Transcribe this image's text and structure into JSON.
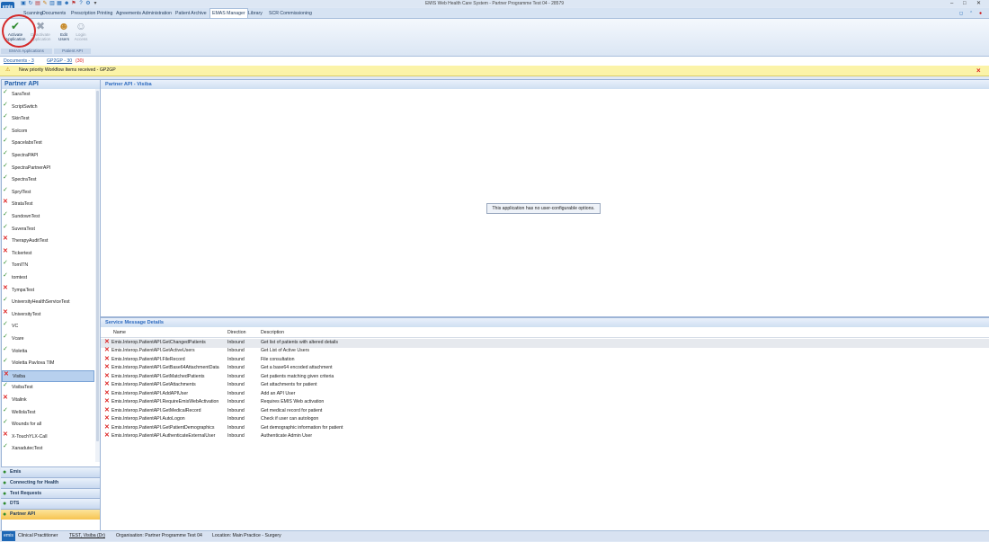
{
  "window": {
    "title": "EMIS Web Health Care System - Partner Programme Test 04 - 28579",
    "controls": [
      "–",
      "□",
      "✕"
    ]
  },
  "logo": "emis",
  "tabs": [
    "Scanning",
    "Documents",
    "Prescription Printing",
    "Agreements Administration",
    "Patient Archive",
    "EMAS Manager",
    "Library",
    "SCR Commissioning"
  ],
  "active_tab": "EMAS Manager",
  "ribbon": {
    "buttons": [
      {
        "label1": "Activate",
        "label2": "Application",
        "icon": "check-icon",
        "enabled": true
      },
      {
        "label1": "Deactivate",
        "label2": "Application",
        "icon": "cross-icon",
        "enabled": false
      },
      {
        "label1": "Edit",
        "label2": "Users",
        "icon": "users-icon",
        "enabled": true
      },
      {
        "label1": "Login",
        "label2": "Access",
        "icon": "login-icon",
        "enabled": false
      }
    ],
    "groups": [
      "EMAS Applications",
      "Patient API"
    ]
  },
  "breadcrumb": {
    "documents": "Documents - 3",
    "gp2gp": "GP2GP - 30",
    "gp2gp_count": "(30)"
  },
  "notification": {
    "text": "New priority Workflow Items received - GP2GP"
  },
  "left_panel": {
    "title": "Partner API",
    "items": [
      {
        "name": "SaraTest",
        "status": "check"
      },
      {
        "name": "ScriptSwitch",
        "status": "check"
      },
      {
        "name": "SkinTest",
        "status": "check"
      },
      {
        "name": "Solcom",
        "status": "check"
      },
      {
        "name": "SpacelabsTest",
        "status": "check"
      },
      {
        "name": "SpectraPAPI",
        "status": "check"
      },
      {
        "name": "SpectraPartnerAPI",
        "status": "check"
      },
      {
        "name": "SpectraTest",
        "status": "check"
      },
      {
        "name": "SprylTest",
        "status": "check"
      },
      {
        "name": "StrataTest",
        "status": "cross"
      },
      {
        "name": "SundownTest",
        "status": "check"
      },
      {
        "name": "SuveraTest",
        "status": "check"
      },
      {
        "name": "TherapyAuditTest",
        "status": "cross"
      },
      {
        "name": "Tickertest",
        "status": "cross"
      },
      {
        "name": "TomITN",
        "status": "check"
      },
      {
        "name": "tomtest",
        "status": "check"
      },
      {
        "name": "TympaTest",
        "status": "cross"
      },
      {
        "name": "UniversityHealthServiceTest",
        "status": "check"
      },
      {
        "name": "UniversityTest",
        "status": "cross"
      },
      {
        "name": "VC",
        "status": "check"
      },
      {
        "name": "Vcare",
        "status": "check"
      },
      {
        "name": "Violetta",
        "status": "check"
      },
      {
        "name": "Violetta Pavlova TIM",
        "status": "check"
      },
      {
        "name": "Visiba",
        "status": "cross"
      },
      {
        "name": "VisibaTest",
        "status": "check"
      },
      {
        "name": "Vitalink",
        "status": "cross"
      },
      {
        "name": "WellolaTest",
        "status": "check"
      },
      {
        "name": "Wounds for all",
        "status": "check"
      },
      {
        "name": "X-TouchYLX-Call",
        "status": "cross"
      },
      {
        "name": "XanadutecTest",
        "status": "check"
      }
    ],
    "selected": "Visiba"
  },
  "nav_sections": [
    "Emis",
    "Connecting for Health",
    "Test Requests",
    "DTS",
    "Partner API"
  ],
  "active_nav": "Partner API",
  "detail": {
    "header": "Partner API - Visiba",
    "message": "This application has no user-configurable options."
  },
  "service": {
    "header": "Service Message Details",
    "columns": [
      "Name",
      "Direction",
      "Description"
    ],
    "rows": [
      {
        "name": "Emis.Interop.PatientAPI.GetChangedPatients",
        "direction": "Inbound",
        "description": "Get list of patients with altered details"
      },
      {
        "name": "Emis.Interop.PatientAPI.GetActiveUsers",
        "direction": "Inbound",
        "description": "Get List of Active Users"
      },
      {
        "name": "Emis.Interop.PatientAPI.FileRecord",
        "direction": "Inbound",
        "description": "File consultation"
      },
      {
        "name": "Emis.Interop.PatientAPI.GetBase64AttachmentData",
        "direction": "Inbound",
        "description": "Get a base64 encoded attachment"
      },
      {
        "name": "Emis.Interop.PatientAPI.GetMatchedPatients",
        "direction": "Inbound",
        "description": "Get patients matching given criteria"
      },
      {
        "name": "Emis.Interop.PatientAPI.GetAttachments",
        "direction": "Inbound",
        "description": "Get attachments for patient"
      },
      {
        "name": "Emis.Interop.PatientAPI.AddAPIUser",
        "direction": "Inbound",
        "description": "Add an API User"
      },
      {
        "name": "Emis.Interop.PatientAPI.RequireEmisWebActivation",
        "direction": "Inbound",
        "description": "Requires EMIS Web activation"
      },
      {
        "name": "Emis.Interop.PatientAPI.GetMedicalRecord",
        "direction": "Inbound",
        "description": "Get medical record for patient"
      },
      {
        "name": "Emis.Interop.PatientAPI.AutoLogon",
        "direction": "Inbound",
        "description": "Check if user can autologon"
      },
      {
        "name": "Emis.Interop.PatientAPI.GetPatientDemographics",
        "direction": "Inbound",
        "description": "Get demographic information for patient"
      },
      {
        "name": "Emis.Interop.PatientAPI.AuthenticateExternalUser",
        "direction": "Inbound",
        "description": "Authenticate Admin User"
      }
    ]
  },
  "status_bar": {
    "role": "Clinical Practitioner",
    "user": "TEST, Visiba (Dr)",
    "organisation": "Organisation: Partner Programme Test 04",
    "location": "Location: Main Practice - Surgery"
  }
}
